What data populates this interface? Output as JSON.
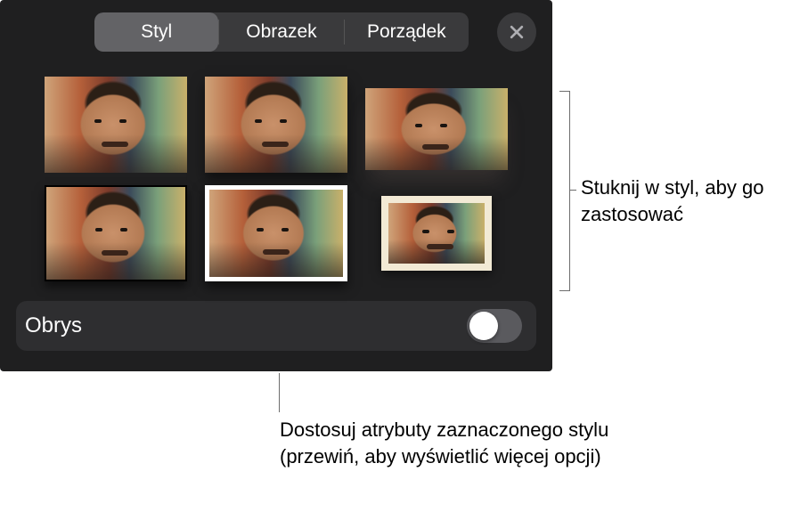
{
  "tabs": {
    "style": "Styl",
    "image": "Obrazek",
    "order": "Porządek",
    "active": "style"
  },
  "styles_grid": {
    "items": [
      {
        "name": "style-plain"
      },
      {
        "name": "style-shadow"
      },
      {
        "name": "style-reflection"
      },
      {
        "name": "style-thin-black-border"
      },
      {
        "name": "style-white-border"
      },
      {
        "name": "style-cream-frame"
      }
    ]
  },
  "outline_row": {
    "label": "Obrys",
    "switch_on": false
  },
  "callouts": {
    "style_tap": "Stuknij w styl, aby go zastosować",
    "adjust": "Dostosuj atrybuty zaznaczonego stylu (przewiń, aby wyświetlić więcej opcji)"
  }
}
